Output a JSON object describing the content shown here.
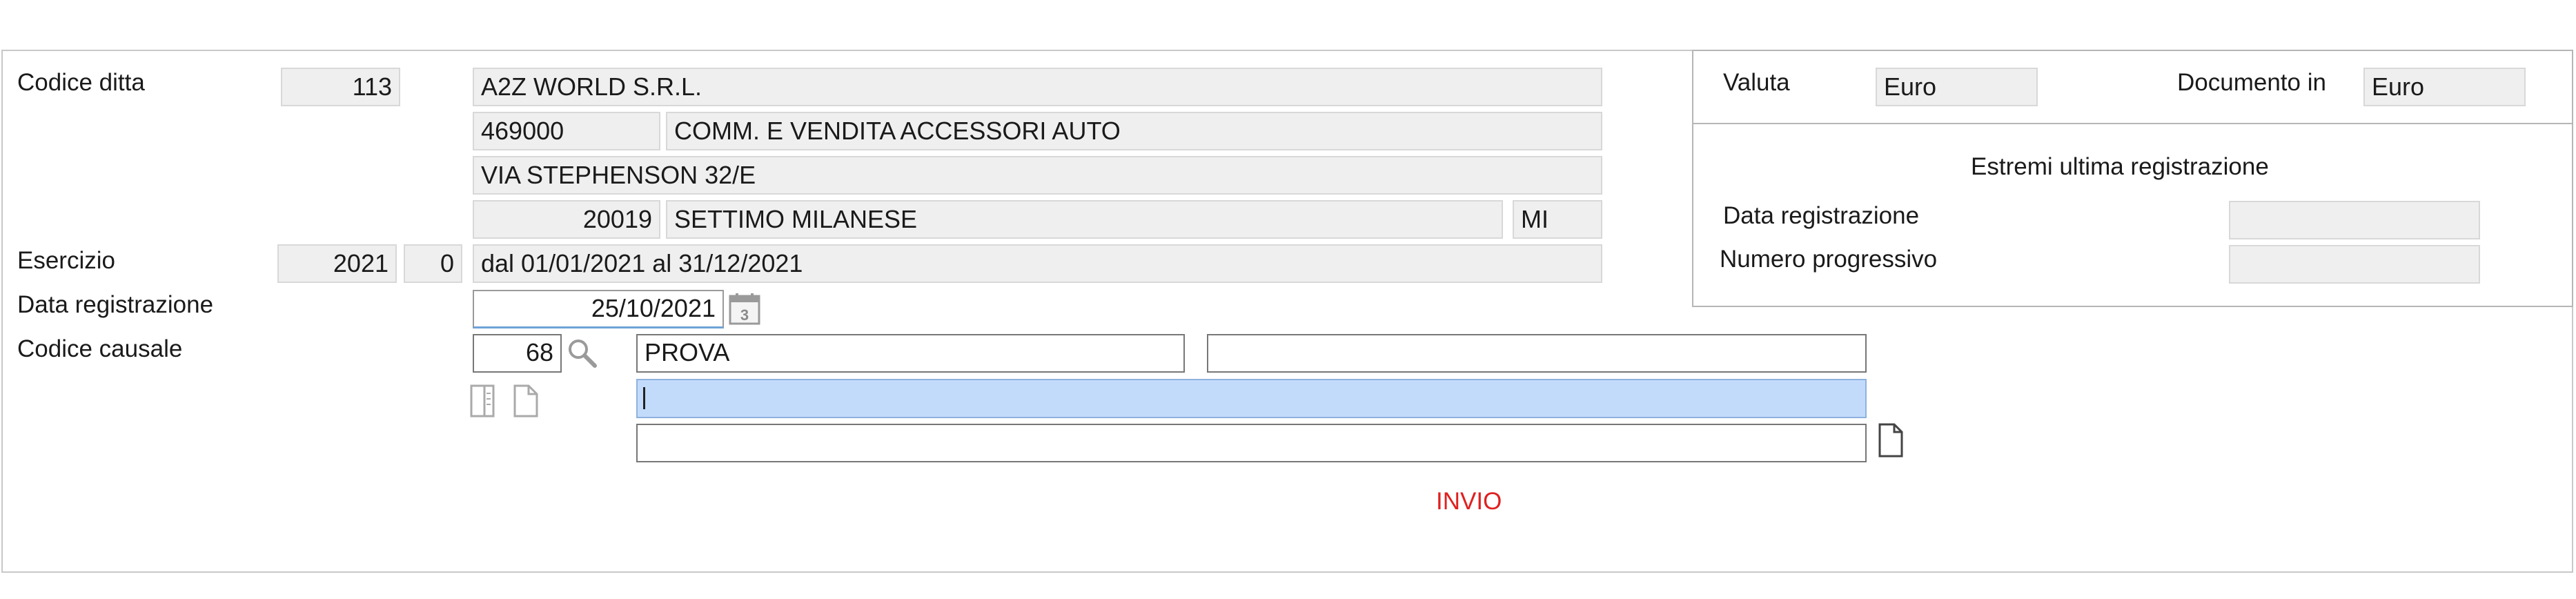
{
  "company": {
    "label": "Codice ditta",
    "code": "113",
    "name": "A2Z WORLD S.R.L.",
    "activity_code": "469000",
    "activity_desc": "COMM. E  VENDITA ACCESSORI AUTO",
    "address": "VIA STEPHENSON 32/E",
    "cap": "20019",
    "city": "SETTIMO MILANESE",
    "province": "MI"
  },
  "esercizio": {
    "label": "Esercizio",
    "year": "2021",
    "index": "0",
    "period": "dal 01/01/2021 al 31/12/2021"
  },
  "registration": {
    "label": "Data registrazione",
    "date": "25/10/2021",
    "calendar_day": "3"
  },
  "causale": {
    "label": "Codice causale",
    "code": "68",
    "description": "PROVA",
    "extra": "",
    "note1": "",
    "note2": ""
  },
  "right_panel": {
    "valuta_label": "Valuta",
    "valuta_value": "Euro",
    "documento_label": "Documento in",
    "documento_value": "Euro",
    "section_title": "Estremi ultima registrazione",
    "data_reg_label": "Data registrazione",
    "data_reg_value": "",
    "numero_label": "Numero progressivo",
    "numero_value": ""
  },
  "footer": {
    "invio": "INVIO"
  },
  "icons": {
    "calendar": "calendar-icon",
    "search": "search-icon",
    "document_list": "document-list-icon",
    "document": "document-icon",
    "new_document": "new-document-icon"
  }
}
